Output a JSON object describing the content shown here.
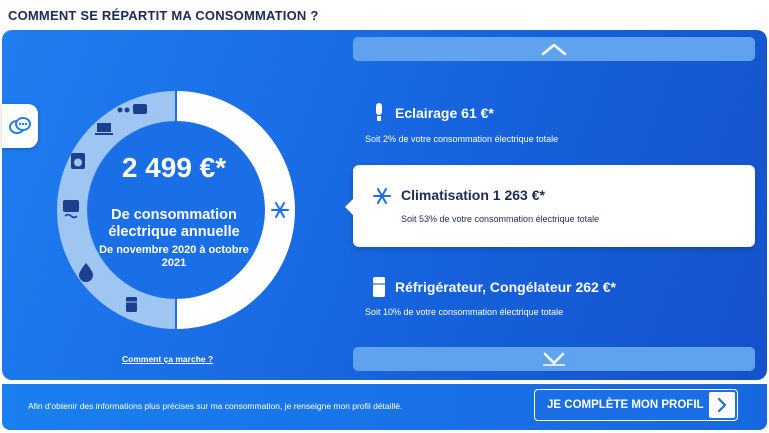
{
  "page": {
    "title": "COMMENT SE RÉPARTIT MA CONSOMMATION ?"
  },
  "summary": {
    "amount": "2 499 €*",
    "line1": "De consommation électrique annuelle",
    "line2": "De novembre 2020 à octobre 2021",
    "how_link": "Comment ça marche ?"
  },
  "categories": [
    {
      "icon": "lightbulb-icon",
      "title": "Eclairage 61 €*",
      "subtitle": "Soit 2% de votre consommation électrique totale",
      "share": 2
    },
    {
      "icon": "snowflake-icon",
      "title": "Climatisation 1 263 €*",
      "subtitle": "Soit 53% de votre consommation électrique totale",
      "share": 53,
      "selected": true
    },
    {
      "icon": "fridge-icon",
      "title": "Réfrigérateur, Congélateur 262 €*",
      "subtitle": "Soit 10% de votre consommation électrique totale",
      "share": 10
    }
  ],
  "footer": {
    "text": "Afin d'obtenir des informations plus précises sur ma consommation, je renseigne mon profil détaillé.",
    "cta_label": "JE COMPLÈTE MON PROFIL"
  },
  "colors": {
    "panel": "#1a6ee6",
    "ring_selected": "#ffffff",
    "nav": "#5fa3ee",
    "title": "#1d2a55"
  }
}
